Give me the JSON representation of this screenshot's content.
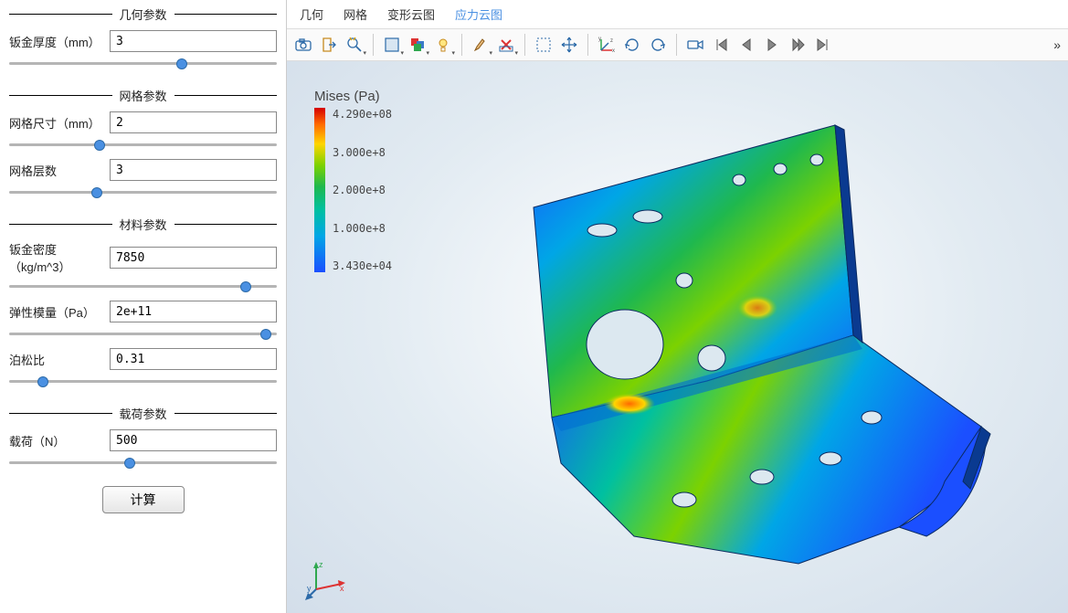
{
  "sections": {
    "geom": {
      "title": "几何参数",
      "thickness": {
        "label": "钣金厚度（mm）",
        "value": "3",
        "slider": 65
      }
    },
    "mesh": {
      "title": "网格参数",
      "size": {
        "label": "网格尺寸（mm）",
        "value": "2",
        "slider": 33
      },
      "layers": {
        "label": "网格层数",
        "value": "3",
        "slider": 32
      }
    },
    "mat": {
      "title": "材料参数",
      "density": {
        "label": "钣金密度（kg/m^3）",
        "value": "7850",
        "slider": 90
      },
      "young": {
        "label": "弹性模量（Pa）",
        "value": "2e+11",
        "slider": 98
      },
      "poisson": {
        "label": "泊松比",
        "value": "0.31",
        "slider": 11
      }
    },
    "load": {
      "title": "载荷参数",
      "force": {
        "label": "载荷（N）",
        "value": "500",
        "slider": 45
      }
    }
  },
  "calculate": "计算",
  "tabs": {
    "t0": "几何",
    "t1": "网格",
    "t2": "变形云图",
    "t3": "应力云图",
    "activeIndex": 3
  },
  "toolbar": {
    "camera": "camera-icon",
    "export": "export-icon",
    "zoomfit": "zoom-fit-icon",
    "render": "render-mode-icon",
    "render2": "render-mode2-icon",
    "color": "color-map-icon",
    "light": "light-icon",
    "brush": "brush-icon",
    "delete": "delete-icon",
    "selbox": "select-box-icon",
    "pan": "pan-icon",
    "axes": "axes-icon",
    "rotcw": "rotate-cw-icon",
    "rotccw": "rotate-ccw-icon",
    "anim": "camera-anim-icon",
    "first": "first-frame-icon",
    "prev": "prev-frame-icon",
    "play": "play-icon",
    "next": "next-frame-icon",
    "last": "last-frame-icon",
    "more": "»"
  },
  "legend": {
    "title": "Mises (Pa)",
    "v0": "4.290e+08",
    "v1": "3.000e+8",
    "v2": "2.000e+8",
    "v3": "1.000e+8",
    "v4": "3.430e+04"
  },
  "triad": {
    "x": "x",
    "y": "y",
    "z": "z"
  }
}
